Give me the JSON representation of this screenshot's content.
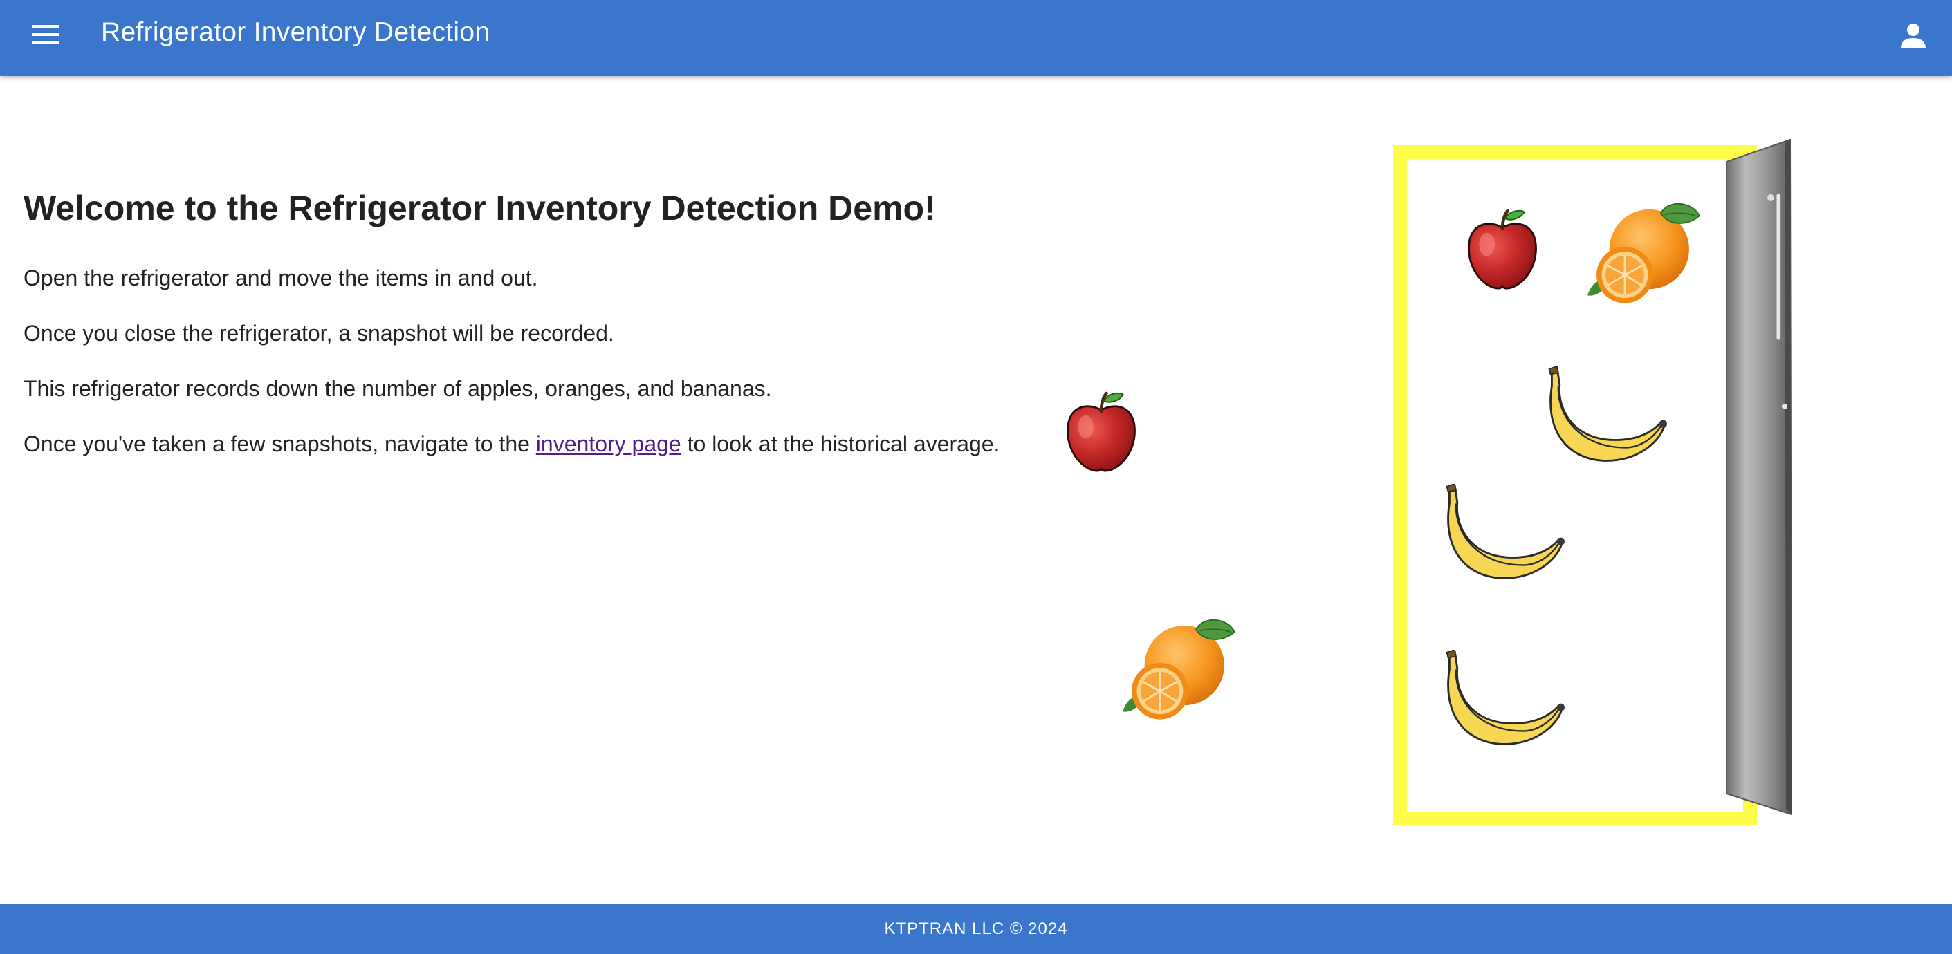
{
  "app_bar": {
    "title": "Refrigerator Inventory Detection",
    "menu_icon": "menu-icon",
    "account_icon": "account-icon"
  },
  "main": {
    "heading": "Welcome to the Refrigerator Inventory Detection Demo!",
    "paragraphs": [
      "Open the refrigerator and move the items in and out.",
      "Once you close the refrigerator, a snapshot will be recorded.",
      "This refrigerator records down the number of apples, oranges, and bananas."
    ],
    "last_paragraph": {
      "before_link": "Once you've taken a few snapshots, navigate to the ",
      "link_text": "inventory page",
      "after_link": " to look at the historical average."
    }
  },
  "scene": {
    "outside_items": [
      "apple",
      "orange"
    ],
    "fridge_items": [
      "apple",
      "orange",
      "banana",
      "banana",
      "banana"
    ]
  },
  "footer": {
    "text": "KTPTRAN LLC © 2024"
  },
  "colors": {
    "primary": "#3b76cd",
    "fridge_border": "#fdfd4a",
    "link": "#551a8b"
  }
}
